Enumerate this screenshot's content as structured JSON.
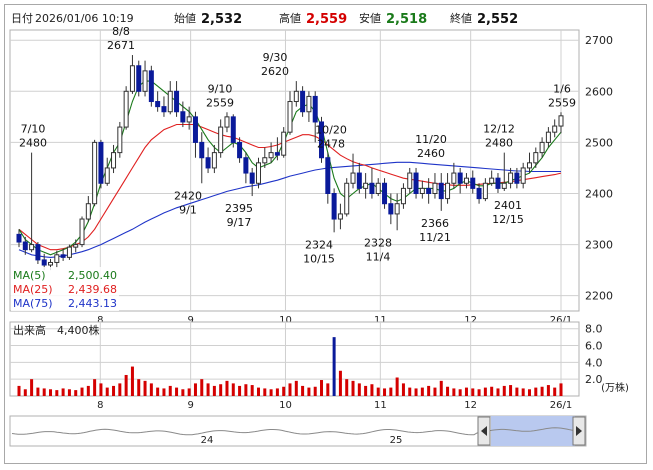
{
  "header": {
    "date_label": "日付",
    "datetime": "2026/01/06 10:19",
    "open_label": "始値",
    "open": "2,532",
    "high_label": "高値",
    "high": "2,559",
    "low_label": "安値",
    "low": "2,518",
    "close_label": "終値",
    "close": "2,552"
  },
  "colors": {
    "up": "#ffffff",
    "down": "#0a1a9a",
    "ma5": "#1a7a1a",
    "ma25": "#e02020",
    "ma75": "#1f34c8",
    "volume": "#d40000",
    "volume_highlight": "#0a1a9a",
    "high_value": "#d40000",
    "low_value": "#1a7a1a",
    "grid": "#d0d0d0",
    "navigator_fill": "#b9c9ef"
  },
  "legend": [
    {
      "label": "MA(5)",
      "value": "2,500.40"
    },
    {
      "label": "MA(25)",
      "value": "2,439.68"
    },
    {
      "label": "MA(75)",
      "value": "2,443.13"
    }
  ],
  "volume": {
    "title": "出来高",
    "value": "4,400株",
    "unit": "(万株)"
  },
  "navigator": {
    "labels": [
      "24",
      "25"
    ]
  },
  "chart_data": {
    "type": "candlestick",
    "y_ticks": [
      "2700",
      "2600",
      "2500",
      "2400",
      "2300",
      "2200"
    ],
    "y_range": [
      2170,
      2720
    ],
    "x_ticks": [
      "8",
      "9",
      "10",
      "11",
      "12",
      "26/1"
    ],
    "volume_ticks": [
      "8.0",
      "6.0",
      "4.0",
      "2.0"
    ],
    "volume_range": [
      0,
      8.8
    ],
    "annotations": [
      {
        "date": "7/10",
        "value": "2480"
      },
      {
        "date": "8/8",
        "value": "2671"
      },
      {
        "date": "9/1",
        "value": "2420"
      },
      {
        "date": "9/10",
        "value": "2559"
      },
      {
        "date": "9/17",
        "value": "2395"
      },
      {
        "date": "9/30",
        "value": "2620"
      },
      {
        "date": "10/15",
        "value": "2324"
      },
      {
        "date": "10/20",
        "value": "2478"
      },
      {
        "date": "11/4",
        "value": "2328"
      },
      {
        "date": "11/20",
        "value": "2460"
      },
      {
        "date": "11/21",
        "value": "2366"
      },
      {
        "date": "12/12",
        "value": "2480"
      },
      {
        "date": "12/15",
        "value": "2401"
      },
      {
        "date": "1/6",
        "value": "2559"
      }
    ],
    "candles": [
      [
        2320,
        2305,
        2330,
        2295
      ],
      [
        2305,
        2290,
        2315,
        2280
      ],
      [
        2290,
        2300,
        2480,
        2285
      ],
      [
        2300,
        2270,
        2305,
        2262
      ],
      [
        2270,
        2260,
        2282,
        2250
      ],
      [
        2260,
        2265,
        2272,
        2250
      ],
      [
        2265,
        2280,
        2288,
        2255
      ],
      [
        2280,
        2275,
        2292,
        2268
      ],
      [
        2275,
        2295,
        2300,
        2270
      ],
      [
        2295,
        2300,
        2310,
        2285
      ],
      [
        2300,
        2350,
        2355,
        2295
      ],
      [
        2350,
        2380,
        2395,
        2345
      ],
      [
        2380,
        2500,
        2505,
        2375
      ],
      [
        2500,
        2420,
        2505,
        2410
      ],
      [
        2420,
        2450,
        2470,
        2415
      ],
      [
        2450,
        2480,
        2495,
        2440
      ],
      [
        2480,
        2530,
        2540,
        2470
      ],
      [
        2530,
        2600,
        2610,
        2525
      ],
      [
        2600,
        2650,
        2671,
        2595
      ],
      [
        2650,
        2600,
        2660,
        2590
      ],
      [
        2600,
        2640,
        2660,
        2590
      ],
      [
        2640,
        2580,
        2650,
        2570
      ],
      [
        2580,
        2570,
        2600,
        2560
      ],
      [
        2570,
        2560,
        2590,
        2550
      ],
      [
        2560,
        2600,
        2620,
        2555
      ],
      [
        2600,
        2560,
        2620,
        2550
      ],
      [
        2560,
        2540,
        2580,
        2530
      ],
      [
        2540,
        2550,
        2570,
        2525
      ],
      [
        2550,
        2500,
        2560,
        2470
      ],
      [
        2500,
        2470,
        2520,
        2420
      ],
      [
        2470,
        2450,
        2490,
        2440
      ],
      [
        2450,
        2480,
        2495,
        2440
      ],
      [
        2480,
        2530,
        2545,
        2470
      ],
      [
        2530,
        2550,
        2559,
        2520
      ],
      [
        2550,
        2500,
        2555,
        2490
      ],
      [
        2500,
        2470,
        2510,
        2460
      ],
      [
        2470,
        2440,
        2480,
        2420
      ],
      [
        2440,
        2420,
        2450,
        2395
      ],
      [
        2420,
        2460,
        2470,
        2410
      ],
      [
        2460,
        2470,
        2490,
        2450
      ],
      [
        2470,
        2480,
        2500,
        2460
      ],
      [
        2480,
        2475,
        2510,
        2465
      ],
      [
        2475,
        2520,
        2530,
        2470
      ],
      [
        2520,
        2580,
        2600,
        2515
      ],
      [
        2580,
        2600,
        2620,
        2570
      ],
      [
        2600,
        2560,
        2610,
        2550
      ],
      [
        2560,
        2590,
        2600,
        2540
      ],
      [
        2590,
        2540,
        2600,
        2500
      ],
      [
        2540,
        2470,
        2550,
        2460
      ],
      [
        2470,
        2400,
        2480,
        2380
      ],
      [
        2400,
        2350,
        2410,
        2324
      ],
      [
        2350,
        2360,
        2380,
        2330
      ],
      [
        2360,
        2420,
        2430,
        2355
      ],
      [
        2420,
        2440,
        2478,
        2410
      ],
      [
        2440,
        2410,
        2460,
        2400
      ],
      [
        2410,
        2420,
        2440,
        2390
      ],
      [
        2420,
        2400,
        2450,
        2390
      ],
      [
        2400,
        2420,
        2430,
        2395
      ],
      [
        2420,
        2380,
        2430,
        2370
      ],
      [
        2380,
        2360,
        2400,
        2340
      ],
      [
        2360,
        2380,
        2400,
        2328
      ],
      [
        2380,
        2410,
        2420,
        2370
      ],
      [
        2410,
        2440,
        2450,
        2400
      ],
      [
        2440,
        2400,
        2450,
        2390
      ],
      [
        2400,
        2410,
        2425,
        2390
      ],
      [
        2410,
        2400,
        2430,
        2380
      ],
      [
        2400,
        2420,
        2440,
        2390
      ],
      [
        2420,
        2390,
        2440,
        2366
      ],
      [
        2390,
        2420,
        2440,
        2380
      ],
      [
        2420,
        2440,
        2460,
        2410
      ],
      [
        2440,
        2420,
        2450,
        2400
      ],
      [
        2420,
        2430,
        2440,
        2410
      ],
      [
        2430,
        2410,
        2445,
        2400
      ],
      [
        2410,
        2390,
        2420,
        2380
      ],
      [
        2390,
        2420,
        2430,
        2385
      ],
      [
        2420,
        2430,
        2445,
        2415
      ],
      [
        2430,
        2410,
        2440,
        2401
      ],
      [
        2410,
        2420,
        2480,
        2405
      ],
      [
        2420,
        2440,
        2450,
        2410
      ],
      [
        2440,
        2420,
        2450,
        2410
      ],
      [
        2420,
        2450,
        2460,
        2410
      ],
      [
        2450,
        2460,
        2480,
        2440
      ],
      [
        2460,
        2480,
        2490,
        2450
      ],
      [
        2480,
        2500,
        2510,
        2470
      ],
      [
        2500,
        2520,
        2530,
        2490
      ],
      [
        2520,
        2532,
        2545,
        2510
      ],
      [
        2532,
        2552,
        2559,
        2518
      ]
    ],
    "ma5": [
      2330,
      2310,
      2300,
      2290,
      2285,
      2280,
      2285,
      2290,
      2295,
      2305,
      2320,
      2345,
      2380,
      2420,
      2450,
      2480,
      2500,
      2540,
      2580,
      2610,
      2620,
      2620,
      2610,
      2600,
      2590,
      2580,
      2570,
      2560,
      2545,
      2525,
      2505,
      2490,
      2480,
      2490,
      2500,
      2495,
      2480,
      2460,
      2450,
      2455,
      2460,
      2475,
      2500,
      2530,
      2560,
      2570,
      2575,
      2560,
      2530,
      2480,
      2430,
      2400,
      2390,
      2400,
      2410,
      2415,
      2420,
      2410,
      2400,
      2390,
      2385,
      2390,
      2400,
      2410,
      2410,
      2410,
      2410,
      2405,
      2405,
      2410,
      2420,
      2425,
      2420,
      2415,
      2415,
      2420,
      2420,
      2420,
      2425,
      2430,
      2435,
      2440,
      2455,
      2470,
      2490,
      2505,
      2520
    ],
    "ma25": [
      2330,
      2320,
      2310,
      2300,
      2295,
      2290,
      2290,
      2292,
      2295,
      2300,
      2305,
      2315,
      2330,
      2350,
      2370,
      2390,
      2410,
      2430,
      2450,
      2470,
      2490,
      2505,
      2515,
      2525,
      2530,
      2535,
      2535,
      2535,
      2535,
      2530,
      2525,
      2520,
      2515,
      2512,
      2510,
      2505,
      2500,
      2495,
      2490,
      2490,
      2492,
      2495,
      2500,
      2505,
      2510,
      2515,
      2515,
      2512,
      2505,
      2495,
      2485,
      2475,
      2468,
      2462,
      2458,
      2455,
      2450,
      2446,
      2442,
      2438,
      2434,
      2430,
      2428,
      2426,
      2424,
      2422,
      2420,
      2418,
      2417,
      2416,
      2416,
      2416,
      2417,
      2418,
      2419,
      2420,
      2421,
      2422,
      2423,
      2425,
      2427,
      2429,
      2431,
      2433,
      2435,
      2437,
      2440
    ],
    "ma75": [
      2290,
      2285,
      2280,
      2278,
      2276,
      2275,
      2276,
      2278,
      2280,
      2283,
      2286,
      2290,
      2295,
      2300,
      2306,
      2312,
      2318,
      2324,
      2330,
      2337,
      2344,
      2350,
      2356,
      2362,
      2367,
      2372,
      2376,
      2380,
      2384,
      2388,
      2392,
      2396,
      2400,
      2404,
      2407,
      2410,
      2413,
      2415,
      2417,
      2420,
      2423,
      2426,
      2430,
      2434,
      2437,
      2440,
      2443,
      2446,
      2448,
      2450,
      2451,
      2452,
      2453,
      2454,
      2455,
      2456,
      2457,
      2458,
      2459,
      2460,
      2461,
      2461,
      2461,
      2460,
      2459,
      2458,
      2457,
      2456,
      2455,
      2454,
      2453,
      2452,
      2451,
      2450,
      2449,
      2448,
      2447,
      2446,
      2445,
      2444,
      2444,
      2443,
      2443,
      2443,
      2443,
      2443,
      2443
    ],
    "volume": [
      1.2,
      0.8,
      2.0,
      1.0,
      0.9,
      0.8,
      0.7,
      0.9,
      0.8,
      0.7,
      1.0,
      1.2,
      2.0,
      1.5,
      1.0,
      1.2,
      1.5,
      2.5,
      3.5,
      2.0,
      1.8,
      1.5,
      1.0,
      0.9,
      1.2,
      1.0,
      0.8,
      0.9,
      1.5,
      2.0,
      1.5,
      1.2,
      1.4,
      1.8,
      1.5,
      1.2,
      1.4,
      1.3,
      1.0,
      0.9,
      0.8,
      0.9,
      1.1,
      1.5,
      1.8,
      1.2,
      1.0,
      1.1,
      1.9,
      1.5,
      7.0,
      3.0,
      2.0,
      1.8,
      1.5,
      1.2,
      1.4,
      1.0,
      0.9,
      1.0,
      2.2,
      1.5,
      1.0,
      0.9,
      1.0,
      1.2,
      1.0,
      1.8,
      1.1,
      0.9,
      0.8,
      1.0,
      0.9,
      0.8,
      1.0,
      1.1,
      0.9,
      1.2,
      1.3,
      1.0,
      0.9,
      0.8,
      1.0,
      1.1,
      1.3,
      1.0,
      1.5
    ]
  }
}
